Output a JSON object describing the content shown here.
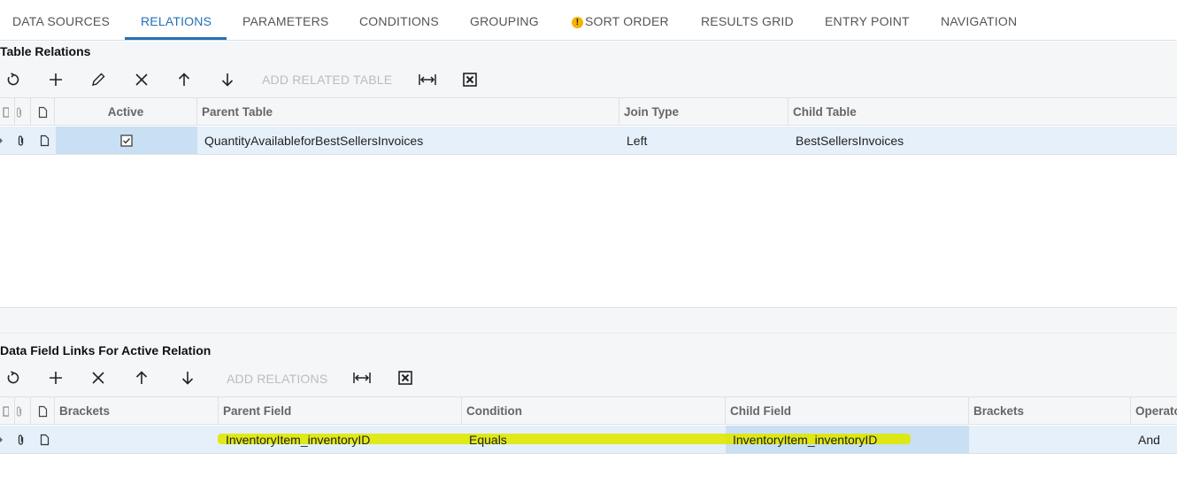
{
  "tabs": [
    {
      "label": "DATA SOURCES"
    },
    {
      "label": "RELATIONS",
      "active": true
    },
    {
      "label": "PARAMETERS"
    },
    {
      "label": "CONDITIONS"
    },
    {
      "label": "GROUPING"
    },
    {
      "label": "SORT ORDER",
      "warning": true
    },
    {
      "label": "RESULTS GRID"
    },
    {
      "label": "ENTRY POINT"
    },
    {
      "label": "NAVIGATION"
    }
  ],
  "relations": {
    "title": "Table Relations",
    "toolbar": {
      "icons": [
        "refresh-icon",
        "plus-icon",
        "pencil-icon",
        "close-icon",
        "arrow-up-icon",
        "arrow-down-icon",
        "fit-width-icon",
        "excel-icon"
      ],
      "add_label": "ADD RELATED TABLE"
    },
    "columns": [
      "Active",
      "Parent Table",
      "Join Type",
      "Child Table"
    ],
    "rows": [
      {
        "active": true,
        "parent_table": "QuantityAvailableforBestSellersInvoices",
        "join_type": "Left",
        "child_table": "BestSellersInvoices"
      }
    ]
  },
  "links": {
    "title": "Data Field Links For Active Relation",
    "toolbar": {
      "icons": [
        "refresh-icon",
        "plus-icon",
        "close-icon",
        "arrow-up-icon",
        "arrow-down-icon",
        "fit-width-icon",
        "excel-icon"
      ],
      "add_label": "ADD RELATIONS"
    },
    "columns": [
      "Brackets",
      "Parent Field",
      "Condition",
      "Child Field",
      "Brackets",
      "Operato"
    ],
    "rows": [
      {
        "open_brackets": "",
        "parent_field": "InventoryItem_inventoryID",
        "condition": "Equals",
        "child_field": "InventoryItem_inventoryID",
        "close_brackets": "",
        "operator": "And"
      }
    ]
  },
  "colors": {
    "accent": "#2271b7",
    "row_selected": "#e6f0fa",
    "cell_focused": "#c9dff3",
    "highlighter": "#dfe800"
  }
}
